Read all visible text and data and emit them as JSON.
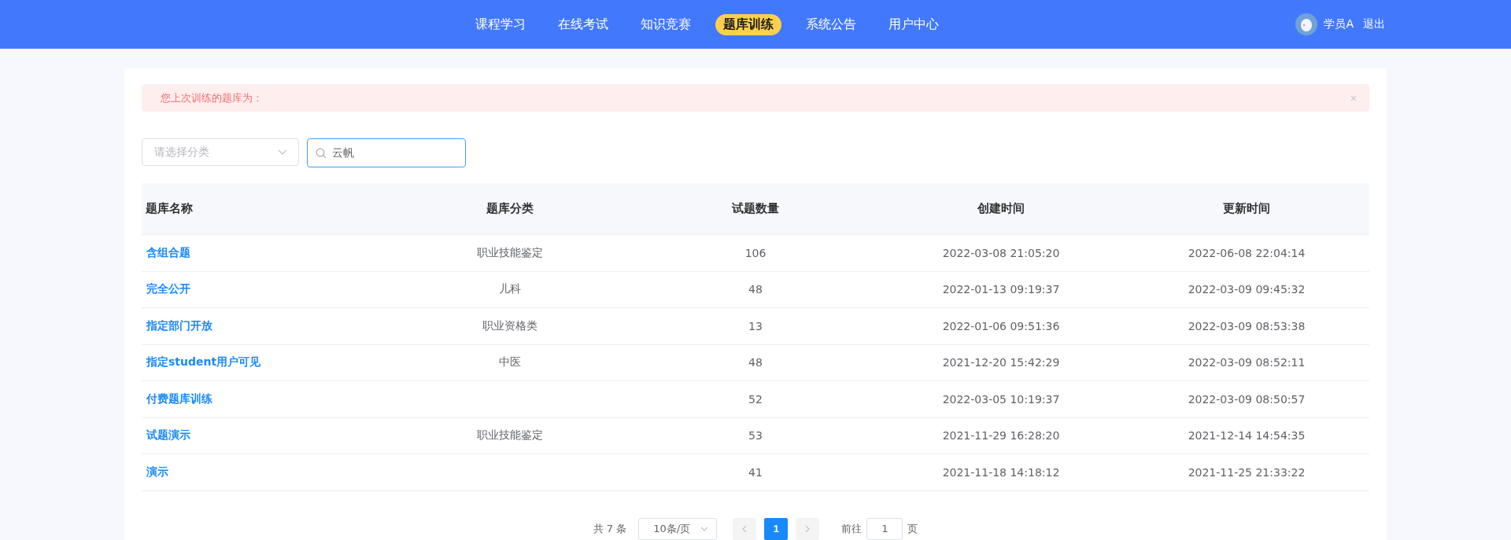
{
  "nav": {
    "items": [
      {
        "label": "课程学习",
        "selected": false
      },
      {
        "label": "在线考试",
        "selected": false
      },
      {
        "label": "知识竞赛",
        "selected": false
      },
      {
        "label": "题库训练",
        "selected": true
      },
      {
        "label": "系统公告",
        "selected": false
      },
      {
        "label": "用户中心",
        "selected": false
      }
    ],
    "user": {
      "name": "学员A",
      "logout": "退出"
    }
  },
  "alert": {
    "text": "您上次训练的题库为：",
    "close": "×"
  },
  "filters": {
    "category": {
      "placeholder": "请选择分类"
    },
    "search": {
      "value": "云帆"
    }
  },
  "table": {
    "columns": [
      "题库名称",
      "题库分类",
      "试题数量",
      "创建时间",
      "更新时间"
    ],
    "rows": [
      {
        "name": "含组合题",
        "category": "职业技能鉴定",
        "count": "106",
        "created": "2022-03-08 21:05:20",
        "updated": "2022-06-08 22:04:14"
      },
      {
        "name": "完全公开",
        "category": "儿科",
        "count": "48",
        "created": "2022-01-13 09:19:37",
        "updated": "2022-03-09 09:45:32"
      },
      {
        "name": "指定部门开放",
        "category": "职业资格类",
        "count": "13",
        "created": "2022-01-06 09:51:36",
        "updated": "2022-03-09 08:53:38"
      },
      {
        "name": "指定student用户可见",
        "category": "中医",
        "count": "48",
        "created": "2021-12-20 15:42:29",
        "updated": "2022-03-09 08:52:11"
      },
      {
        "name": "付费题库训练",
        "count": "52",
        "created": "2022-03-05 10:19:37",
        "updated": "2022-03-09 08:50:57"
      },
      {
        "name": "试题演示",
        "category": "职业技能鉴定",
        "count": "53",
        "created": "2021-11-29 16:28:20",
        "updated": "2021-12-14 14:54:35"
      },
      {
        "name": "演示",
        "count": "41",
        "created": "2021-11-18 14:18:12",
        "updated": "2021-11-25 21:33:22"
      }
    ]
  },
  "pagination": {
    "total": "共 7 条",
    "page_size": "10条/页",
    "pages": [
      {
        "label": "1",
        "selected": true
      }
    ],
    "goto_label": "前往",
    "goto_value": "1",
    "goto_suffix": "页"
  }
}
